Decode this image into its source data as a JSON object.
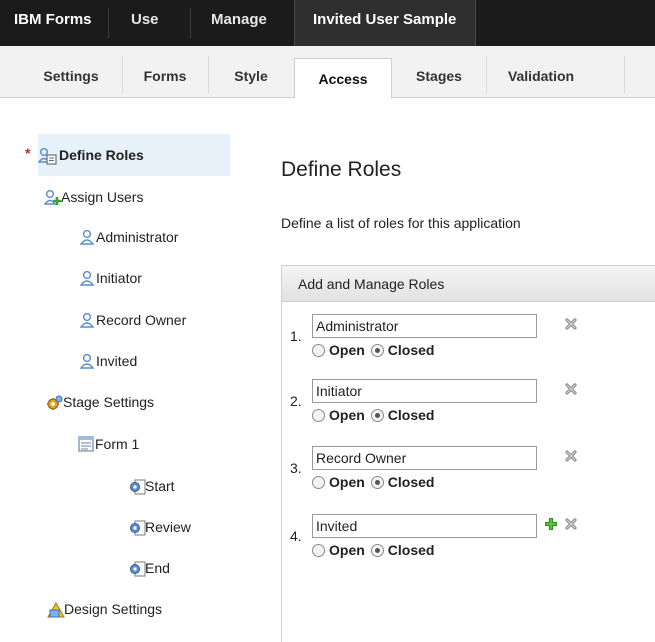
{
  "topnav": {
    "brand": "IBM Forms",
    "use": "Use",
    "manage": "Manage",
    "app_title": "Invited User Sample"
  },
  "tabs": [
    "Settings",
    "Forms",
    "Style",
    "Access",
    "Stages",
    "Validation"
  ],
  "active_tab": "Access",
  "tree": {
    "define_roles": "Define Roles",
    "assign_users": "Assign Users",
    "administrator": "Administrator",
    "initiator": "Initiator",
    "record_owner": "Record Owner",
    "invited": "Invited",
    "stage_settings": "Stage Settings",
    "form1": "Form 1",
    "start": "Start",
    "review": "Review",
    "end": "End",
    "design_settings": "Design Settings"
  },
  "main": {
    "title": "Define Roles",
    "description": "Define a list of roles for this application",
    "panel_title": "Add and Manage Roles",
    "open_label": "Open",
    "closed_label": "Closed"
  },
  "roles": [
    {
      "num": "1.",
      "name": "Administrator",
      "access": "Closed"
    },
    {
      "num": "2.",
      "name": "Initiator",
      "access": "Closed"
    },
    {
      "num": "3.",
      "name": "Record Owner",
      "access": "Closed"
    },
    {
      "num": "4.",
      "name": "Invited",
      "access": "Closed"
    }
  ],
  "colors": {
    "topbar": "#1b1b1b",
    "selected_node": "#e6f1fa",
    "required_marker": "#cc2222",
    "add_icon": "#3aa52d"
  }
}
